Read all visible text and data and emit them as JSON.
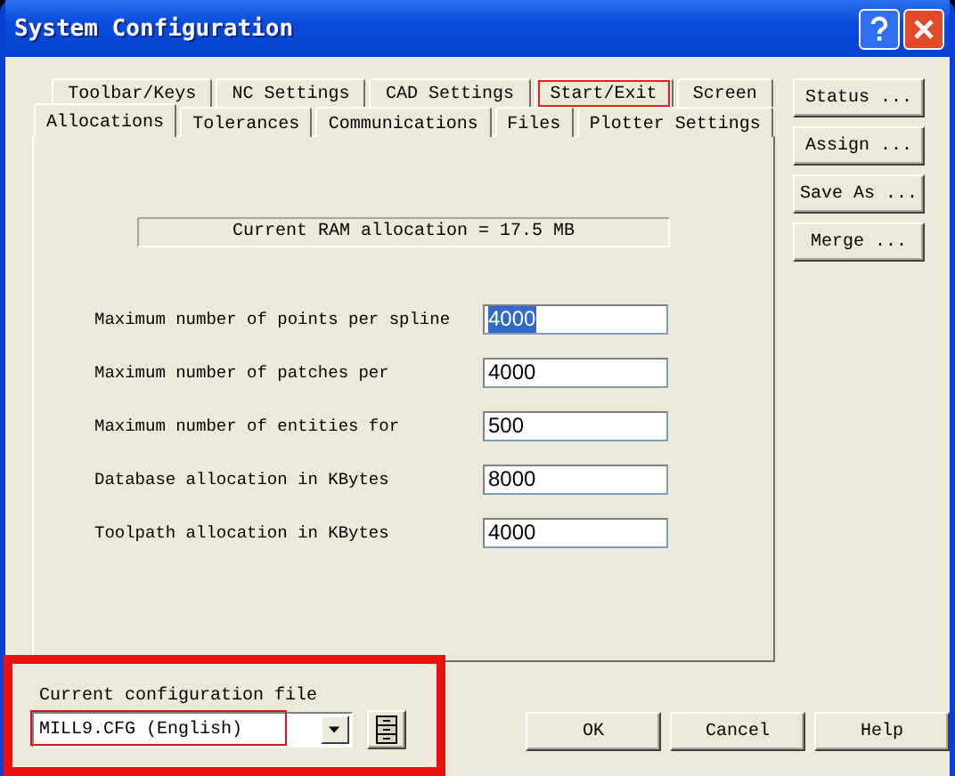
{
  "window": {
    "title": "System Configuration"
  },
  "tab_rows": [
    [
      {
        "label": "Toolbar/Keys",
        "selected": false,
        "highlighted": false
      },
      {
        "label": "NC Settings",
        "selected": false,
        "highlighted": false
      },
      {
        "label": "CAD Settings",
        "selected": false,
        "highlighted": false
      },
      {
        "label": "Start/Exit",
        "selected": false,
        "highlighted": true
      },
      {
        "label": "Screen",
        "selected": false,
        "highlighted": false
      }
    ],
    [
      {
        "label": "Allocations",
        "selected": true,
        "highlighted": false
      },
      {
        "label": "Tolerances",
        "selected": false,
        "highlighted": false
      },
      {
        "label": "Communications",
        "selected": false,
        "highlighted": false
      },
      {
        "label": "Files",
        "selected": false,
        "highlighted": false
      },
      {
        "label": "Plotter Settings",
        "selected": false,
        "highlighted": false
      }
    ]
  ],
  "ram_allocation": "Current RAM allocation = 17.5 MB",
  "fields": [
    {
      "label": "Maximum number of points per spline",
      "value": "4000",
      "focused": true
    },
    {
      "label": "Maximum number of patches per",
      "value": "4000",
      "focused": false
    },
    {
      "label": "Maximum number of entities for",
      "value": "500",
      "focused": false
    },
    {
      "label": "Database allocation in KBytes",
      "value": "8000",
      "focused": false
    },
    {
      "label": "Toolpath allocation in KBytes",
      "value": "4000",
      "focused": false
    }
  ],
  "side_buttons": [
    "Status ...",
    "Assign ...",
    "Save As ...",
    "Merge ..."
  ],
  "config": {
    "label": "Current configuration file",
    "value": "MILL9.CFG (English)",
    "section_highlighted": true,
    "value_highlighted": true
  },
  "buttons": [
    "OK",
    "Cancel",
    "Help"
  ]
}
